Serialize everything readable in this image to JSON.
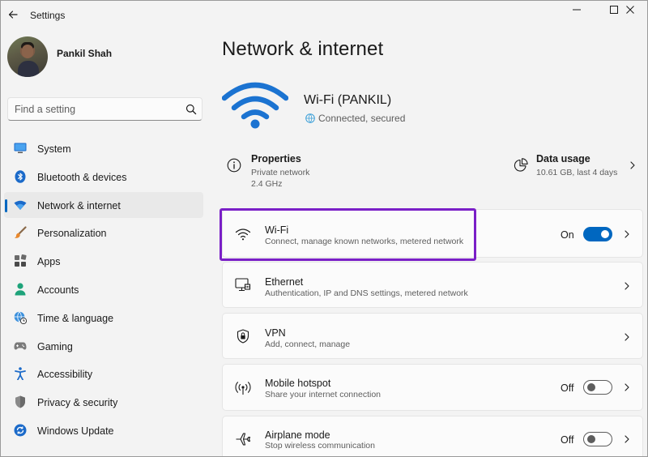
{
  "window": {
    "title": "Settings",
    "accent_color": "#0067c0",
    "highlight_color": "#7a1fc7"
  },
  "profile": {
    "name": "Pankil Shah"
  },
  "search": {
    "placeholder": "Find a setting"
  },
  "sidebar": {
    "items": [
      {
        "label": "System",
        "icon": "monitor-icon",
        "active": false
      },
      {
        "label": "Bluetooth & devices",
        "icon": "bluetooth-icon",
        "active": false
      },
      {
        "label": "Network & internet",
        "icon": "wifi-icon",
        "active": true
      },
      {
        "label": "Personalization",
        "icon": "brush-icon",
        "active": false
      },
      {
        "label": "Apps",
        "icon": "apps-icon",
        "active": false
      },
      {
        "label": "Accounts",
        "icon": "person-icon",
        "active": false
      },
      {
        "label": "Time & language",
        "icon": "globe-clock-icon",
        "active": false
      },
      {
        "label": "Gaming",
        "icon": "gamepad-icon",
        "active": false
      },
      {
        "label": "Accessibility",
        "icon": "accessibility-icon",
        "active": false
      },
      {
        "label": "Privacy & security",
        "icon": "shield-icon",
        "active": false
      },
      {
        "label": "Windows Update",
        "icon": "update-icon",
        "active": false
      }
    ]
  },
  "main": {
    "title": "Network & internet",
    "connection": {
      "name": "Wi-Fi (PANKIL)",
      "status": "Connected, secured"
    },
    "properties": {
      "title": "Properties",
      "network_type": "Private network",
      "band": "2.4 GHz"
    },
    "data_usage": {
      "title": "Data usage",
      "detail": "10.61 GB, last 4 days"
    },
    "cards": [
      {
        "title": "Wi-Fi",
        "subtitle": "Connect, manage known networks, metered network",
        "icon": "wifi-icon",
        "state": "On",
        "toggle": true
      },
      {
        "title": "Ethernet",
        "subtitle": "Authentication, IP and DNS settings, metered network",
        "icon": "ethernet-icon",
        "state": "",
        "toggle": null
      },
      {
        "title": "VPN",
        "subtitle": "Add, connect, manage",
        "icon": "shield-icon",
        "state": "",
        "toggle": null
      },
      {
        "title": "Mobile hotspot",
        "subtitle": "Share your internet connection",
        "icon": "hotspot-icon",
        "state": "Off",
        "toggle": false
      },
      {
        "title": "Airplane mode",
        "subtitle": "Stop wireless communication",
        "icon": "airplane-icon",
        "state": "Off",
        "toggle": false
      }
    ]
  }
}
